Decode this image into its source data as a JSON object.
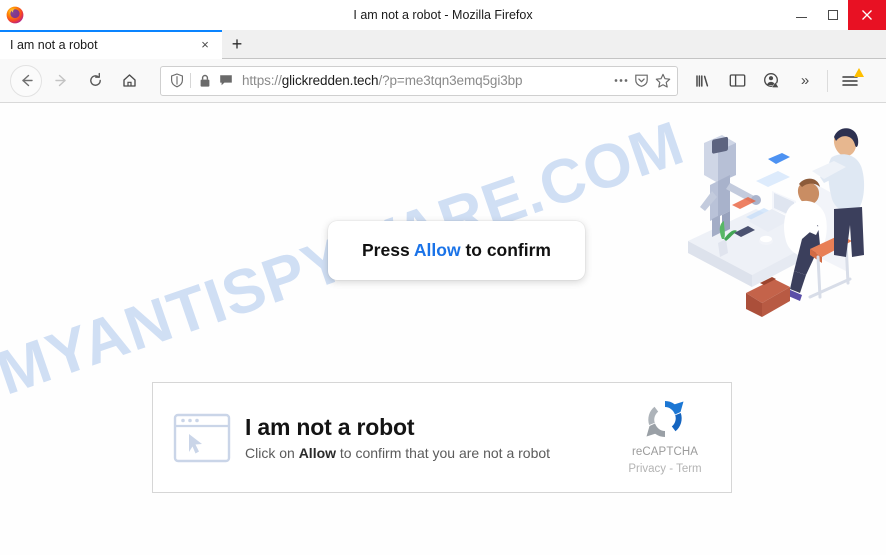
{
  "window": {
    "title": "I am not a robot - Mozilla Firefox",
    "app_icon": "firefox-logo",
    "controls": {
      "minimize": "minimize-icon",
      "maximize": "maximize-icon",
      "close": "close-icon",
      "close_color": "#e81123"
    }
  },
  "tabs": {
    "items": [
      {
        "label": "I am not a robot",
        "close_label": "×",
        "active": true
      }
    ],
    "new_tab_label": "+",
    "active_indicator_color": "#0a84ff"
  },
  "toolbar": {
    "back_icon": "back-arrow-icon",
    "forward_icon": "forward-arrow-icon",
    "reload_icon": "reload-icon",
    "home_icon": "home-icon",
    "library_icon": "library-icon",
    "sidebar_icon": "sidebar-icon",
    "account_icon": "account-warning-icon",
    "overflow_label": "»",
    "menu_icon": "hamburger-menu-icon",
    "menu_badge_color": "#ffbf00"
  },
  "urlbar": {
    "shield_icon": "tracking-protection-shield-icon",
    "lock_icon": "padlock-icon",
    "permission_icon": "notification-bubble-icon",
    "scheme": "https://",
    "host": "glickredden.tech",
    "path": "/?p=me3tqn3emq5gi3bp",
    "page_actions_label": "•••",
    "pocket_icon": "pocket-icon",
    "bookmark_icon": "star-icon"
  },
  "page": {
    "watermark": "MYANTISPYWARE.COM",
    "watermark_color": "#c9daf3",
    "background": "#fefefe",
    "notification": {
      "prefix": "Press ",
      "highlight": "Allow",
      "suffix": " to confirm",
      "highlight_color": "#1a73e8"
    },
    "captcha": {
      "icon": "browser-window-cursor-icon",
      "title": "I am not a robot",
      "subtitle_prefix": "Click on ",
      "subtitle_bold": "Allow",
      "subtitle_suffix": " to confirm that you are not a robot",
      "recaptcha": {
        "logo_icon": "recaptcha-logo-icon",
        "name": "reCAPTCHA",
        "links": "Privacy - Term"
      }
    },
    "illustration": {
      "name": "isometric-office-robot-illustration",
      "elements": [
        "robot",
        "man-at-desk-with-laptop",
        "woman-with-tablet",
        "briefcase",
        "potted-plant",
        "orange-stool"
      ]
    }
  }
}
